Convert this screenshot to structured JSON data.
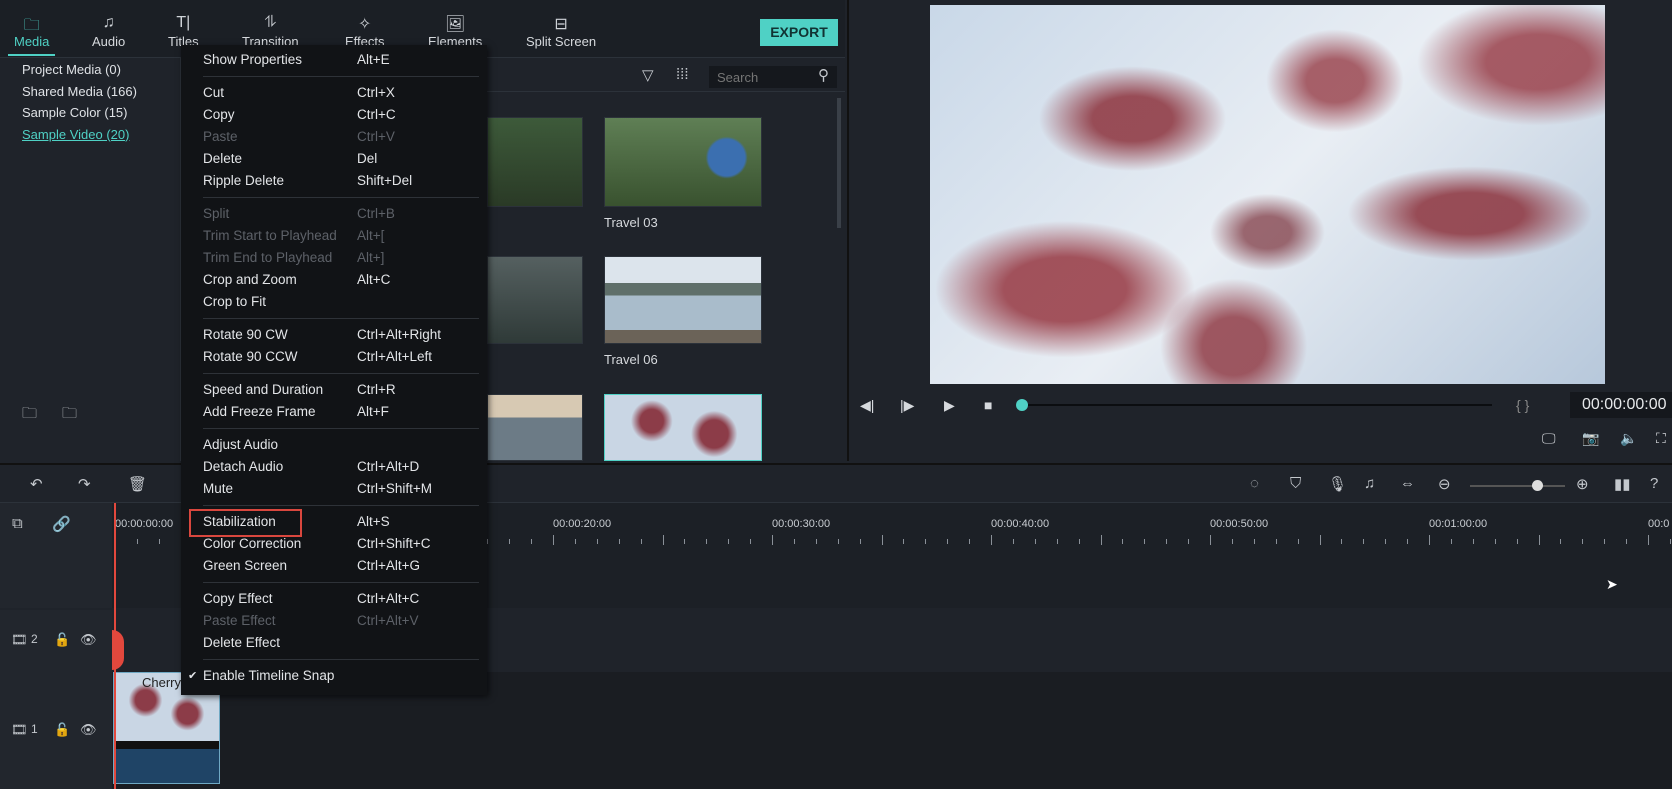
{
  "nav": {
    "tabs": [
      {
        "label": "Media",
        "icon": "folder-icon"
      },
      {
        "label": "Audio",
        "icon": "music-note-icon"
      },
      {
        "label": "Titles",
        "icon": "text-icon"
      },
      {
        "label": "Transition",
        "icon": "transition-icon"
      },
      {
        "label": "Effects",
        "icon": "effects-icon"
      },
      {
        "label": "Elements",
        "icon": "image-icon"
      },
      {
        "label": "Split Screen",
        "icon": "split-screen-icon"
      }
    ],
    "active": "Media",
    "export_label": "EXPORT"
  },
  "sidebar": {
    "items": [
      "Project Media (0)",
      "Shared Media (166)",
      "Sample Color (15)",
      "Sample Video (20)"
    ],
    "selected": "Sample Video (20)"
  },
  "media": {
    "search_placeholder": "Search",
    "thumbnails": [
      {
        "label": ""
      },
      {
        "label": "Travel 03"
      },
      {
        "label": ""
      },
      {
        "label": "Travel 06"
      },
      {
        "label": ""
      },
      {
        "label": ""
      }
    ]
  },
  "preview": {
    "timecode": "00:00:00:00",
    "progress": 0
  },
  "timeline": {
    "ruler": [
      "00:00:00:00",
      "00:00:10:00",
      "00:00:20:00",
      "00:00:30:00",
      "00:00:40:00",
      "00:00:50:00",
      "00:01:00:00",
      "00:0"
    ],
    "tracks": [
      {
        "label": "2"
      },
      {
        "label": "1"
      }
    ],
    "clip_label": "Cherry",
    "zoom_level": 0.7
  },
  "context_menu": {
    "groups": [
      [
        {
          "label": "Show Properties",
          "shortcut": "Alt+E"
        }
      ],
      [
        {
          "label": "Cut",
          "shortcut": "Ctrl+X"
        },
        {
          "label": "Copy",
          "shortcut": "Ctrl+C"
        },
        {
          "label": "Paste",
          "shortcut": "Ctrl+V",
          "disabled": true
        },
        {
          "label": "Delete",
          "shortcut": "Del"
        },
        {
          "label": "Ripple Delete",
          "shortcut": "Shift+Del"
        }
      ],
      [
        {
          "label": "Split",
          "shortcut": "Ctrl+B",
          "disabled": true
        },
        {
          "label": "Trim Start to Playhead",
          "shortcut": "Alt+[",
          "disabled": true
        },
        {
          "label": "Trim End to Playhead",
          "shortcut": "Alt+]",
          "disabled": true
        },
        {
          "label": "Crop and Zoom",
          "shortcut": "Alt+C"
        },
        {
          "label": "Crop to Fit",
          "shortcut": ""
        }
      ],
      [
        {
          "label": "Rotate 90 CW",
          "shortcut": "Ctrl+Alt+Right"
        },
        {
          "label": "Rotate 90 CCW",
          "shortcut": "Ctrl+Alt+Left"
        }
      ],
      [
        {
          "label": "Speed and Duration",
          "shortcut": "Ctrl+R"
        },
        {
          "label": "Add Freeze Frame",
          "shortcut": "Alt+F"
        }
      ],
      [
        {
          "label": "Adjust Audio",
          "shortcut": ""
        },
        {
          "label": "Detach Audio",
          "shortcut": "Ctrl+Alt+D"
        },
        {
          "label": "Mute",
          "shortcut": "Ctrl+Shift+M"
        }
      ],
      [
        {
          "label": "Stabilization",
          "shortcut": "Alt+S",
          "highlighted": true
        },
        {
          "label": "Color Correction",
          "shortcut": "Ctrl+Shift+C"
        },
        {
          "label": "Green Screen",
          "shortcut": "Ctrl+Alt+G"
        }
      ],
      [
        {
          "label": "Copy Effect",
          "shortcut": "Ctrl+Alt+C"
        },
        {
          "label": "Paste Effect",
          "shortcut": "Ctrl+Alt+V",
          "disabled": true
        },
        {
          "label": "Delete Effect",
          "shortcut": ""
        }
      ],
      [
        {
          "label": "Enable Timeline Snap",
          "shortcut": "",
          "checked": true
        }
      ]
    ]
  },
  "colors": {
    "accent": "#4fd1c5",
    "playhead": "#e2483d",
    "highlight_box": "#d9473e"
  }
}
